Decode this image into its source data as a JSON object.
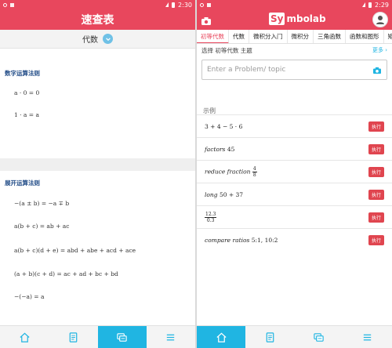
{
  "left": {
    "status_time": "2:30",
    "title": "速查表",
    "selector_value": "代数",
    "section1_title": "数字运算法则",
    "section1_formulas": [
      "a · 0 = 0",
      "1 · a = a"
    ],
    "section2_title": "展开运算法则",
    "section2_formulas": [
      "−(a ± b) = −a ∓ b",
      "a(b + c) = ab + ac",
      "a(b + c)(d + e) = abd + abe + acd + ace",
      "(a + b)(c + d) = ac + ad + bc + bd",
      "−(−a) = a"
    ],
    "bottom_tabs": [
      "home-icon",
      "notes-icon",
      "cheatsheet-icon",
      "menu-icon"
    ],
    "active_tab_index": 2
  },
  "right": {
    "status_time": "2:29",
    "logo_box": "Sy",
    "logo_rest": "mbolab",
    "tabs": [
      "初等代数",
      "代数",
      "微积分入门",
      "微积分",
      "三角函数",
      "函数和图形",
      "矩"
    ],
    "active_tab_index": 0,
    "subject_label": "选择 初等代数 主题",
    "more_label": "更多",
    "search_placeholder": "Enter a Problem/ topic",
    "examples_title": "示例",
    "examples": [
      {
        "prefix": "",
        "expr": "3 + 4 − 5 · 6"
      },
      {
        "prefix": "factors",
        "expr": "45"
      },
      {
        "prefix": "reduce fraction",
        "expr": "",
        "frac_num": "4",
        "frac_den": "8"
      },
      {
        "prefix": "long",
        "expr": "50 + 37"
      },
      {
        "prefix": "",
        "expr": "",
        "frac_num": "12.3",
        "frac_den": "0.3"
      },
      {
        "prefix": "compare ratios",
        "expr": "5:1, 10:2"
      }
    ],
    "run_label": "执行",
    "bottom_tabs": [
      "home-icon",
      "notes-icon",
      "cheatsheet-icon",
      "menu-icon"
    ]
  },
  "colors": {
    "brand_red": "#e8475d",
    "active_blue": "#20b5e2",
    "section_blue": "#1f4a86"
  }
}
